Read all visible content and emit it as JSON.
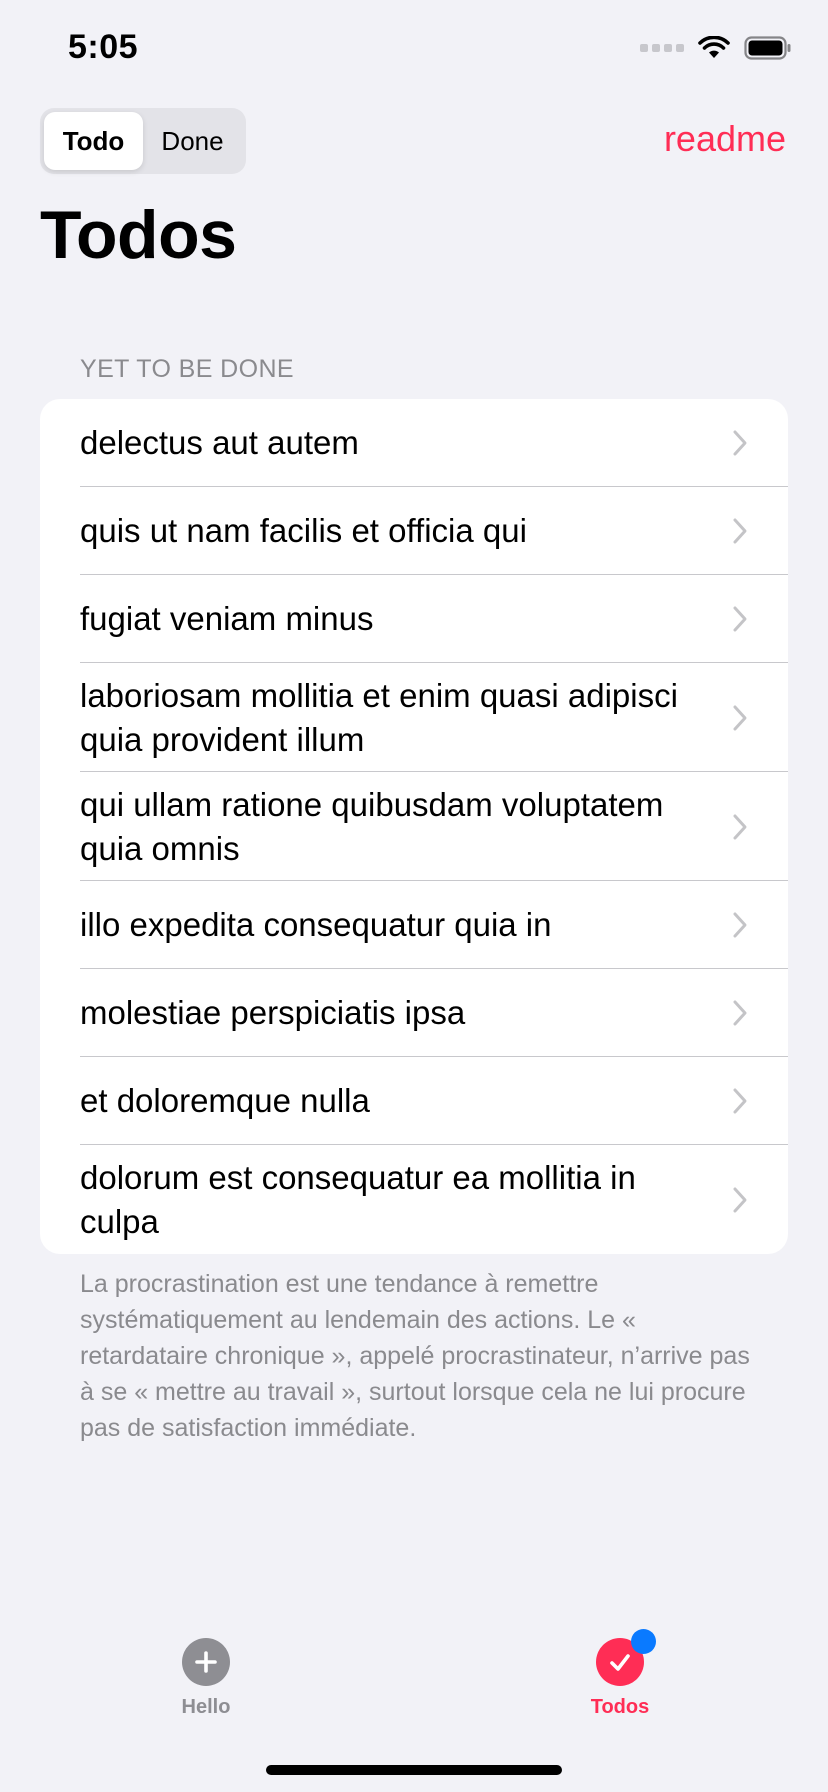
{
  "status_bar": {
    "time": "5:05"
  },
  "nav": {
    "segments": [
      "Todo",
      "Done"
    ],
    "selected_segment": "Todo",
    "readme_label": "readme",
    "title": "Todos"
  },
  "section": {
    "header": "YET TO BE DONE",
    "items": [
      {
        "label": "delectus aut autem"
      },
      {
        "label": "quis ut nam facilis et officia qui"
      },
      {
        "label": "fugiat veniam minus"
      },
      {
        "label": "laboriosam mollitia et enim quasi adipisci quia provident illum"
      },
      {
        "label": "qui ullam ratione quibusdam voluptatem quia omnis"
      },
      {
        "label": "illo expedita consequatur quia in"
      },
      {
        "label": "molestiae perspiciatis ipsa"
      },
      {
        "label": "et doloremque nulla"
      },
      {
        "label": "dolorum est consequatur ea mollitia in culpa"
      }
    ],
    "footer": "La procrastination est une tendance à remettre systématiquement au lendemain des actions. Le « retardataire chronique », appelé procrastinateur, n’arrive pas à se « mettre au travail », surtout lorsque cela ne lui procure pas de satisfaction immédiate."
  },
  "tab_bar": {
    "tabs": [
      {
        "label": "Hello",
        "icon": "plus-circle-icon",
        "selected": false
      },
      {
        "label": "Todos",
        "icon": "checkmark-circle-icon",
        "selected": true,
        "badge": true
      }
    ]
  },
  "colors": {
    "accent": "#ff2d55",
    "badge": "#0a7aff",
    "background": "#f2f2f7",
    "secondary_text": "#8a8a8e"
  }
}
